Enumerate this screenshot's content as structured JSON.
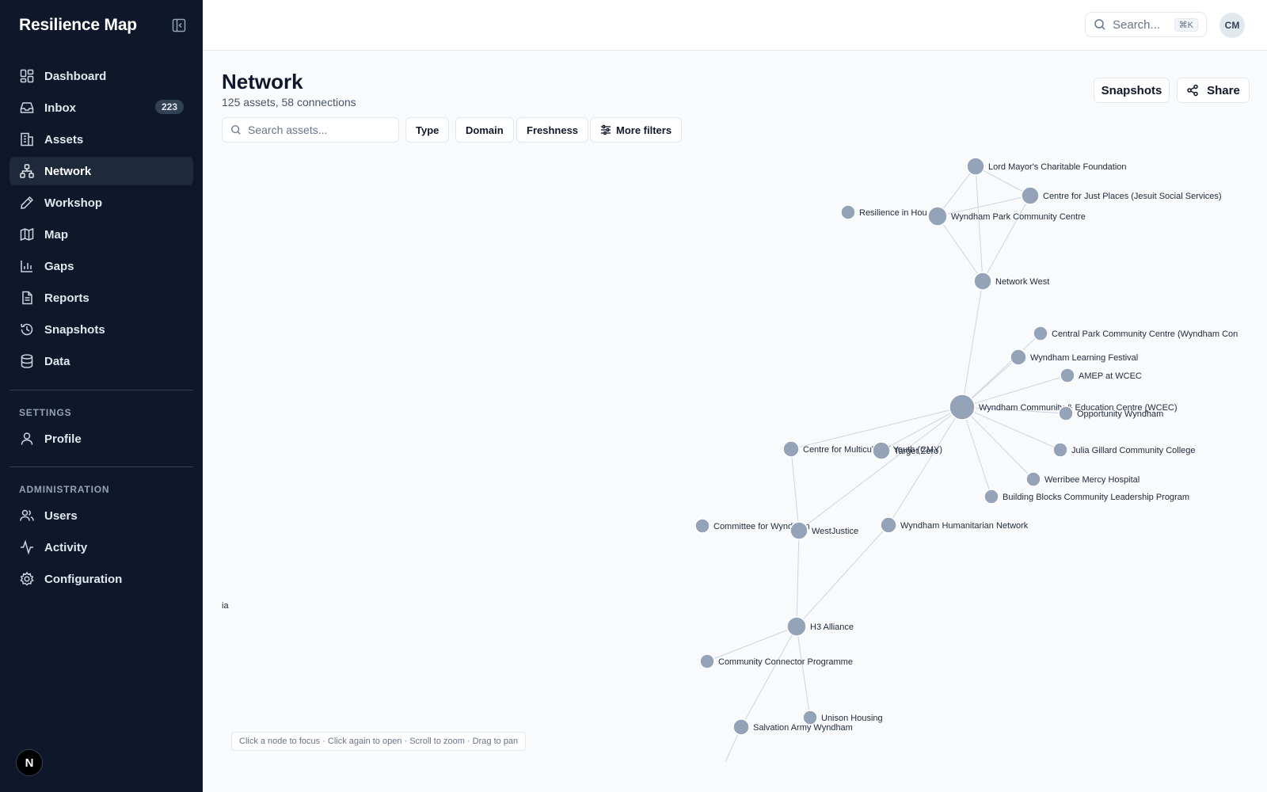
{
  "sidebar": {
    "brand": "Resilience Map",
    "nav": [
      {
        "label": "Dashboard",
        "icon": "dashboard-icon"
      },
      {
        "label": "Inbox",
        "icon": "inbox-icon",
        "badge": "223"
      },
      {
        "label": "Assets",
        "icon": "building-icon"
      },
      {
        "label": "Network",
        "icon": "network-icon",
        "active": true
      },
      {
        "label": "Workshop",
        "icon": "pencil-icon"
      },
      {
        "label": "Map",
        "icon": "map-icon"
      },
      {
        "label": "Gaps",
        "icon": "bar-chart-icon"
      },
      {
        "label": "Reports",
        "icon": "file-text-icon"
      },
      {
        "label": "Snapshots",
        "icon": "history-icon"
      },
      {
        "label": "Data",
        "icon": "database-icon"
      }
    ],
    "settings_label": "SETTINGS",
    "settings": [
      {
        "label": "Profile",
        "icon": "user-icon"
      }
    ],
    "admin_label": "ADMINISTRATION",
    "admin": [
      {
        "label": "Users",
        "icon": "users-icon"
      },
      {
        "label": "Activity",
        "icon": "activity-icon"
      },
      {
        "label": "Configuration",
        "icon": "gear-icon"
      }
    ],
    "footer_logo": "N"
  },
  "header": {
    "search_label": "Search...",
    "search_shortcut": "⌘K",
    "avatar_initials": "CM"
  },
  "page": {
    "title": "Network",
    "subtitle": "125 assets, 58 connections",
    "snapshots_label": "Snapshots",
    "share_label": "Share",
    "search_placeholder": "Search assets...",
    "filters": {
      "type": "Type",
      "domain": "Domain",
      "freshness": "Freshness",
      "more": "More filters"
    },
    "hint": "Click a node to focus · Click again to open · Scroll to zoom · Drag to pan"
  },
  "colors": {
    "sidebar_bg": "#0f172a",
    "node": "#94a3b8",
    "edge": "#cbd5e1"
  },
  "graph": {
    "nodes": [
      {
        "id": "lmcf",
        "label": "Lord Mayor's Charitable Foundation"
      },
      {
        "id": "cjp",
        "label": "Centre for Just Places (Jesuit Social Services)"
      },
      {
        "id": "rih",
        "label": "Resilience in Hou"
      },
      {
        "id": "wpcc",
        "label": "Wyndham Park Community Centre"
      },
      {
        "id": "nw",
        "label": "Network West"
      },
      {
        "id": "cpcc",
        "label": "Central Park Community Centre (Wyndham Con"
      },
      {
        "id": "wlf",
        "label": "Wyndham Learning Festival"
      },
      {
        "id": "amep",
        "label": "AMEP at WCEC"
      },
      {
        "id": "wcec",
        "label": "Wyndham Community & Education Centre (WCEC)"
      },
      {
        "id": "ow",
        "label": "Opportunity Wyndham"
      },
      {
        "id": "cmy",
        "label": "Centre for Multicultural Youth (CMY)"
      },
      {
        "id": "tz",
        "label": "Target Zero"
      },
      {
        "id": "jgcc",
        "label": "Julia Gillard Community College"
      },
      {
        "id": "wmh",
        "label": "Werribee Mercy Hospital"
      },
      {
        "id": "bbclp",
        "label": "Building Blocks Community Leadership Program"
      },
      {
        "id": "cfw",
        "label": "Committee for Wyndham"
      },
      {
        "id": "wj",
        "label": "WestJustice"
      },
      {
        "id": "whn",
        "label": "Wyndham Humanitarian Network"
      },
      {
        "id": "h3",
        "label": "H3 Alliance"
      },
      {
        "id": "ccp",
        "label": "Community Connector Programme"
      },
      {
        "id": "uh",
        "label": "Unison Housing"
      },
      {
        "id": "saw",
        "label": "Salvation Army Wyndham"
      },
      {
        "id": "edge_left",
        "label": "ia"
      }
    ],
    "edges": [
      [
        "lmcf",
        "cjp"
      ],
      [
        "lmcf",
        "wpcc"
      ],
      [
        "lmcf",
        "nw"
      ],
      [
        "cjp",
        "wpcc"
      ],
      [
        "cjp",
        "nw"
      ],
      [
        "wpcc",
        "nw"
      ],
      [
        "nw",
        "wcec"
      ],
      [
        "wcec",
        "cpcc"
      ],
      [
        "wcec",
        "wlf"
      ],
      [
        "wcec",
        "amep"
      ],
      [
        "wcec",
        "ow"
      ],
      [
        "wcec",
        "tz"
      ],
      [
        "wcec",
        "jgcc"
      ],
      [
        "wcec",
        "wmh"
      ],
      [
        "wcec",
        "bbclp"
      ],
      [
        "wcec",
        "cmy"
      ],
      [
        "wcec",
        "wj"
      ],
      [
        "wcec",
        "whn"
      ],
      [
        "cmy",
        "wj"
      ],
      [
        "wj",
        "h3"
      ],
      [
        "whn",
        "h3"
      ],
      [
        "h3",
        "ccp"
      ],
      [
        "h3",
        "uh"
      ],
      [
        "h3",
        "saw"
      ]
    ]
  }
}
